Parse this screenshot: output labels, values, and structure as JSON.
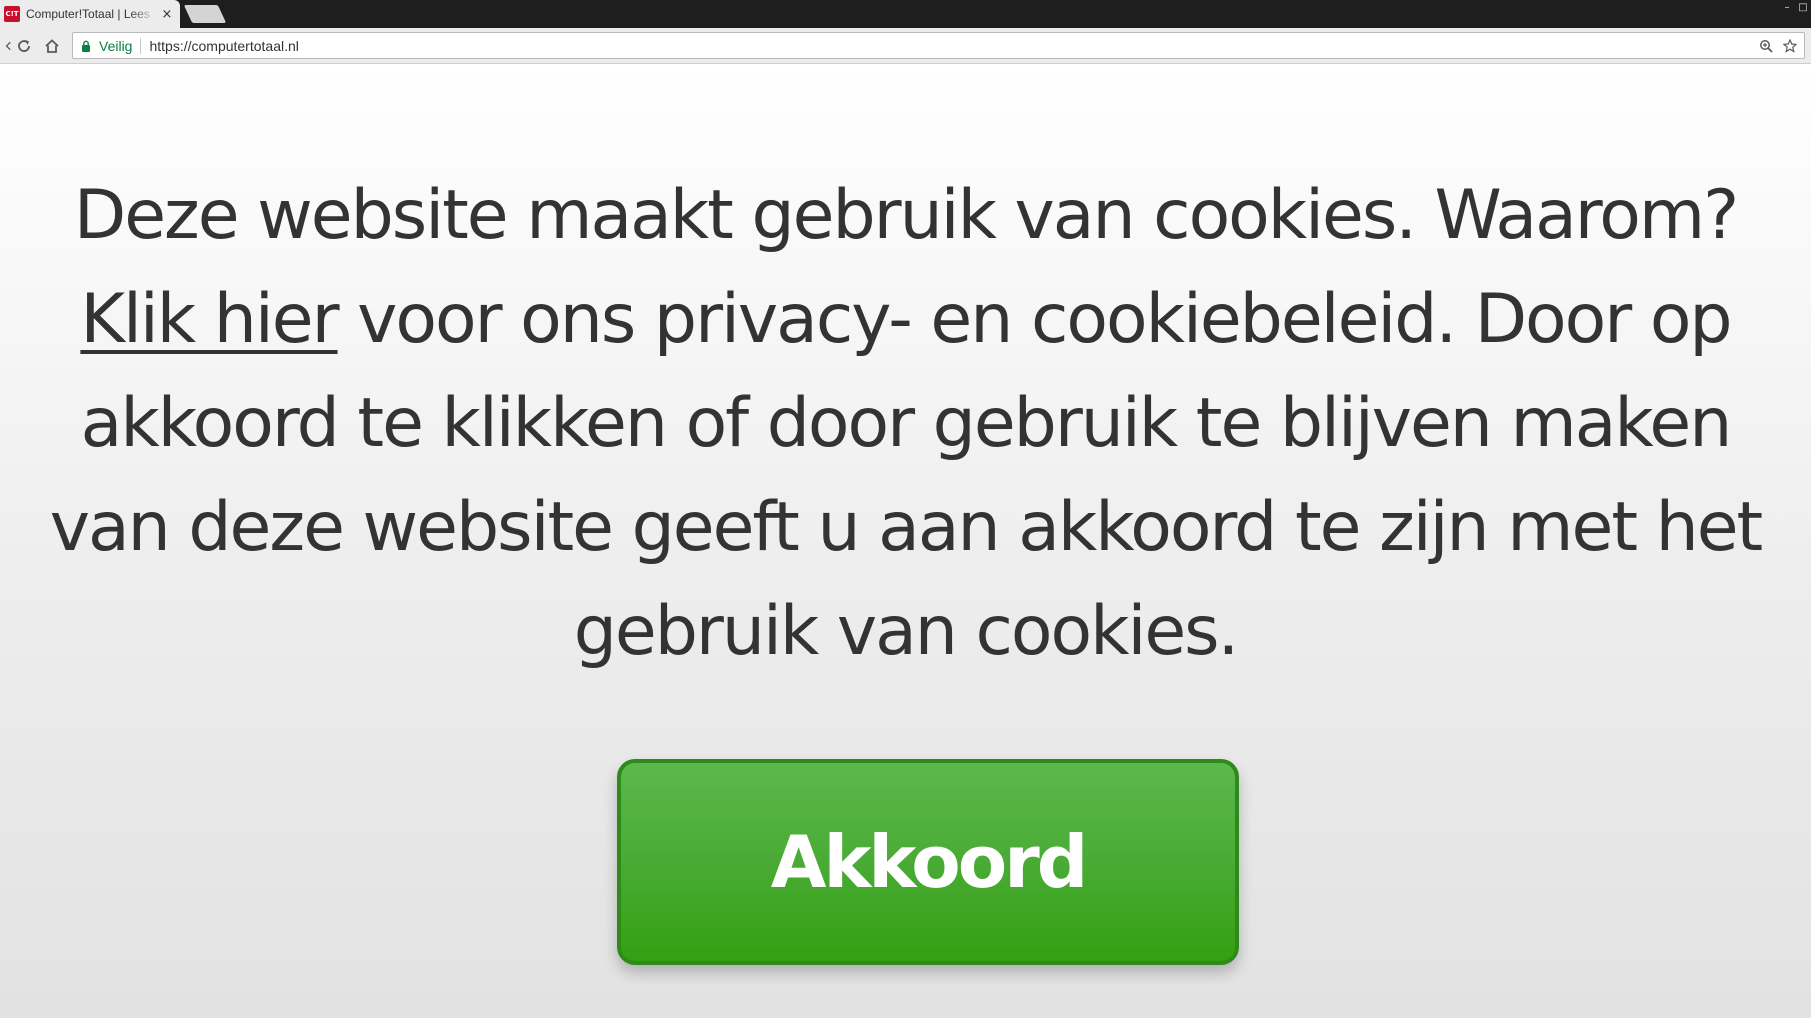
{
  "browser": {
    "tab": {
      "favicon_text": "C!T",
      "title": "Computer!Totaal | Lees alles over",
      "close_glyph": "×"
    },
    "window_controls": {
      "minimize_glyph": "–",
      "maximize_glyph": "□"
    },
    "address_bar": {
      "secure_label": "Veilig",
      "url": "https://computertotaal.nl"
    },
    "icons": {
      "back": "back-arrow-icon",
      "reload": "reload-icon",
      "home": "home-icon",
      "lock": "lock-icon",
      "zoom": "zoom-icon",
      "bookmark": "star-icon"
    }
  },
  "cookie_notice": {
    "text_before_link": "Deze website maakt gebruik van cookies. Waarom? ",
    "link_text": "Klik hier",
    "text_after_link": " voor ons privacy- en cookiebeleid. Door op akkoord te klikken of door gebruik te blijven maken van deze website geeft u aan akkoord te zijn met het gebruik van cookies.",
    "accept_label": "Akkoord"
  },
  "colors": {
    "accept_button": "#49ab35",
    "accept_border": "#2e8b1a",
    "text": "#333333",
    "secure_green": "#0b8043",
    "favicon_red": "#c8102e"
  }
}
